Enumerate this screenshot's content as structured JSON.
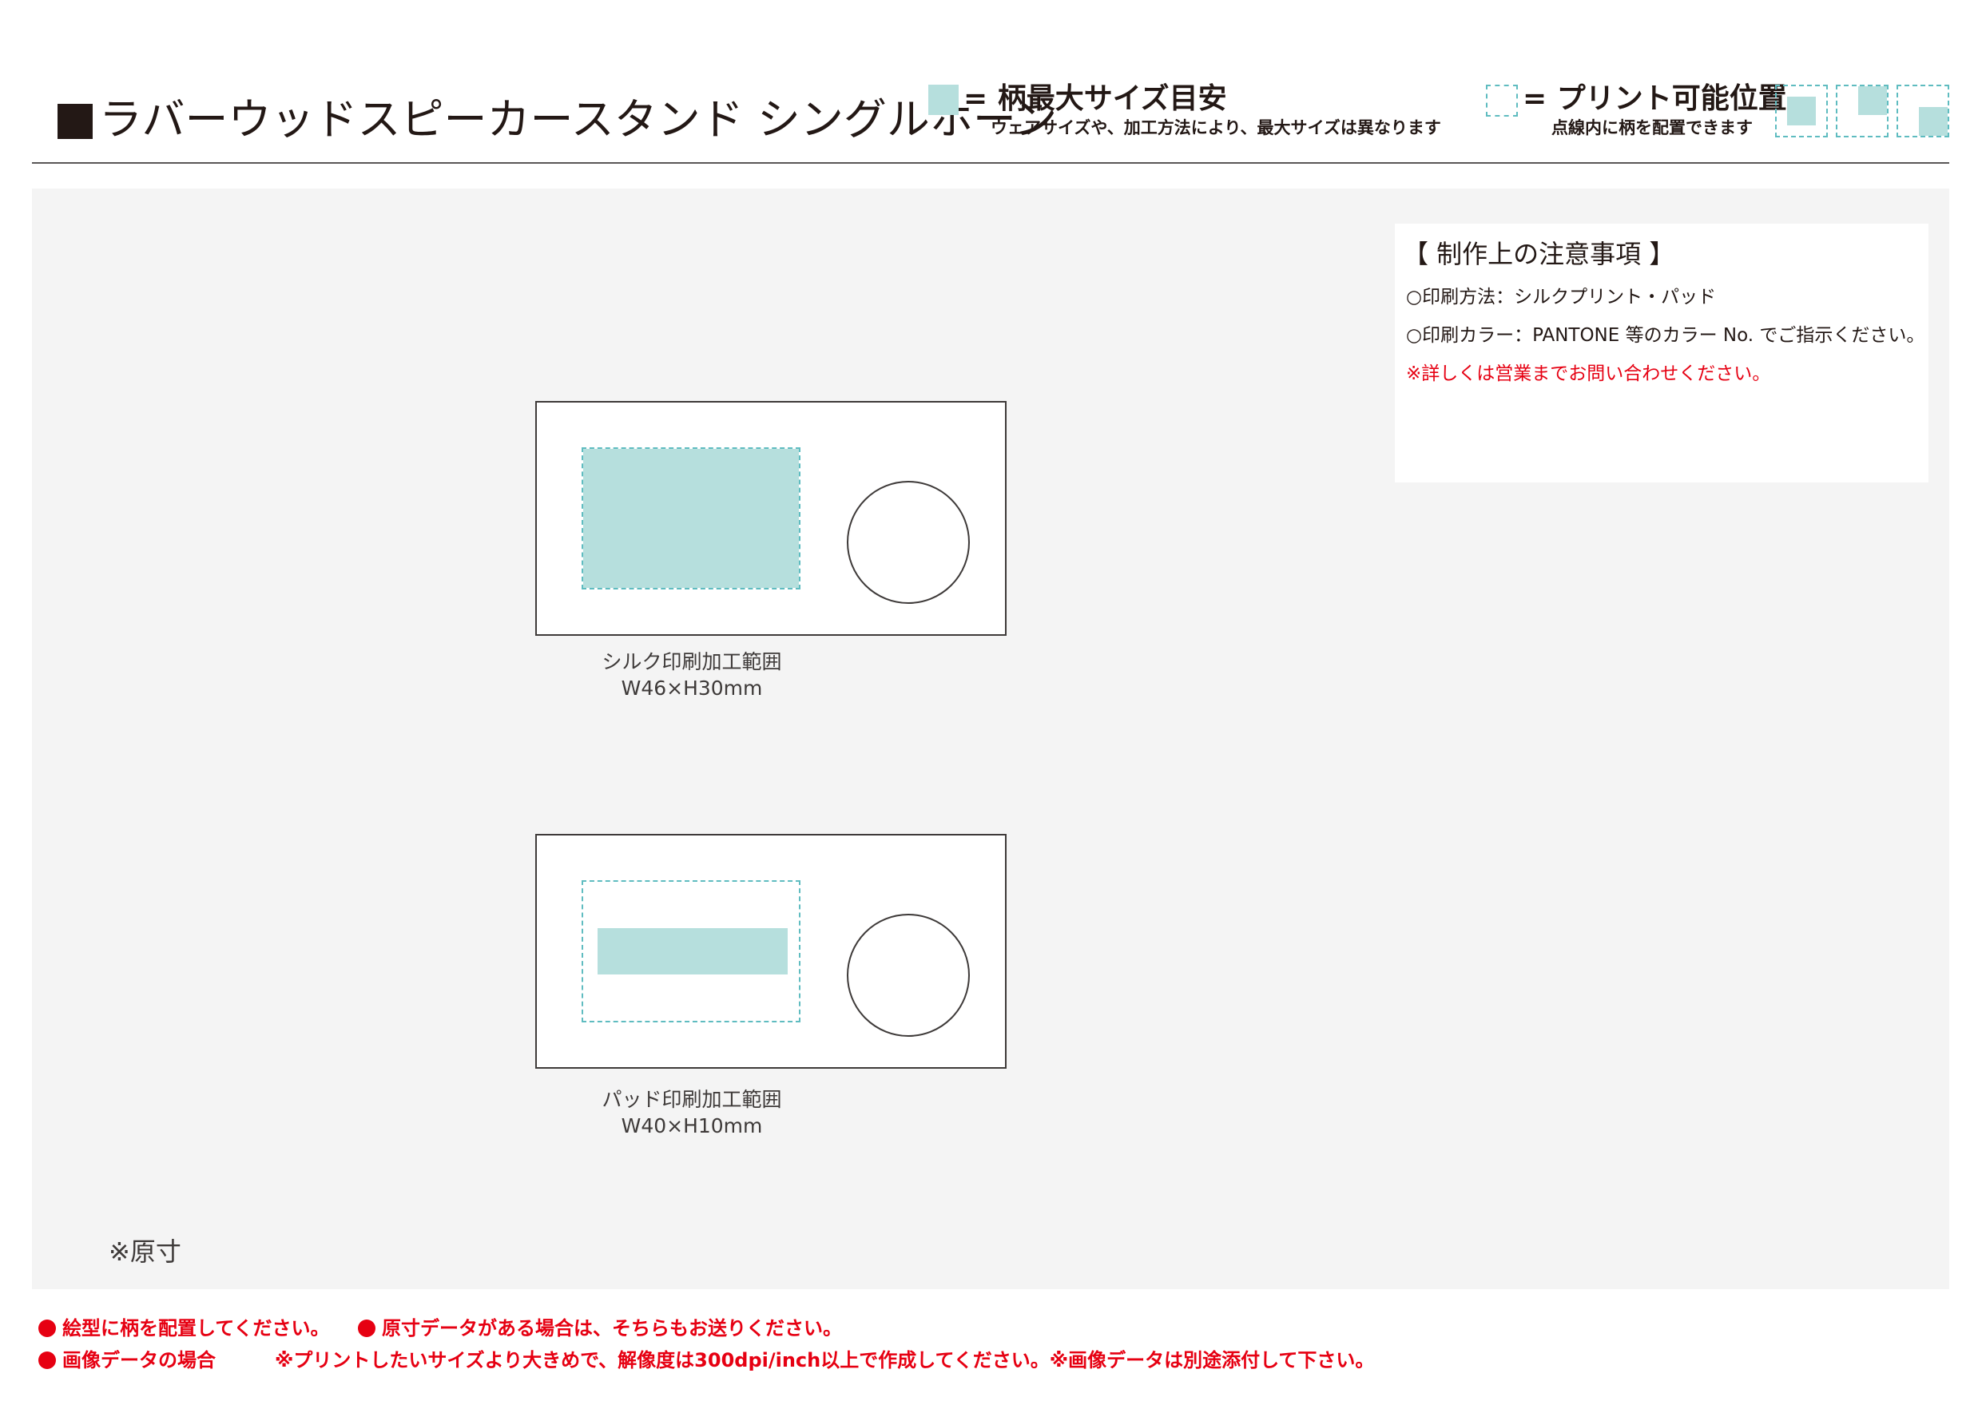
{
  "header": {
    "title": "ラバーウッドスピーカースタンド シングルホーン",
    "legend_design_size": {
      "label": "= 柄最大サイズ目安",
      "description": "ウェアサイズや、加工方法により、最大サイズは異なります"
    },
    "legend_print_area": {
      "label": "= プリント可能位置",
      "description": "点線内に柄を配置できます"
    }
  },
  "products": [
    {
      "caption_line1": "シルク印刷加工範囲",
      "caption_line2": "W46×H30mm"
    },
    {
      "caption_line1": "パッド印刷加工範囲",
      "caption_line2": "W40×H10mm"
    }
  ],
  "actual_size_note": "※原寸",
  "notes": {
    "title": "【 制作上の注意事項 】",
    "method": "○印刷方法：シルクプリント・パッド",
    "color": "○印刷カラー：PANTONE 等のカラー No. でご指示ください。",
    "contact": "※詳しくは営業までお問い合わせください。"
  },
  "footer": {
    "line1_a": "絵型に柄を配置してください。",
    "line1_b": "原寸データがある場合は、そちらもお送りください。",
    "line2_a": "画像データの場合",
    "line2_b": "※プリントしたいサイズより大きめで、解像度は300dpi/inch以上で作成してください。※画像データは別途添付して下さい。"
  },
  "colors": {
    "design_area": "#b6dfdd",
    "dashed_outline": "#5fbcc0",
    "alert_red": "#e60012",
    "panel_bg": "#f4f4f4",
    "text": "#231815"
  }
}
